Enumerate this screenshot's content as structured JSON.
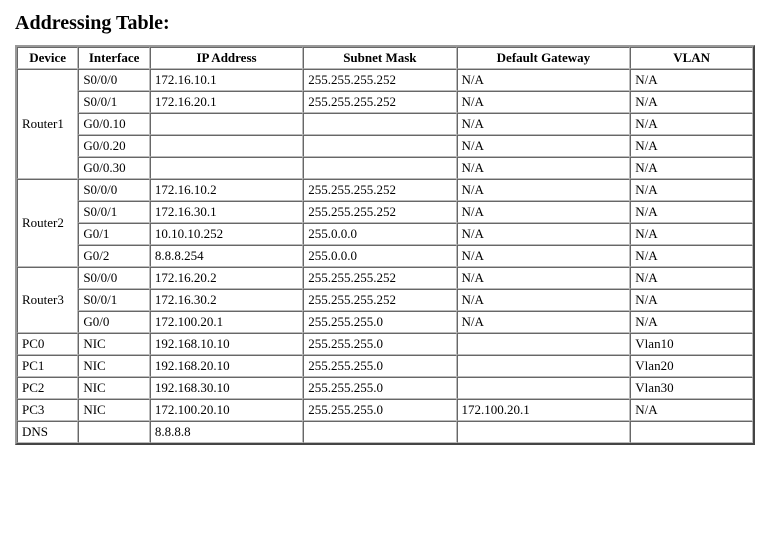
{
  "title": "Addressing Table:",
  "headers": {
    "device": "Device",
    "interface": "Interface",
    "ip": "IP Address",
    "mask": "Subnet Mask",
    "gw": "Default Gateway",
    "vlan": "VLAN"
  },
  "groups": [
    {
      "device": "Router1",
      "rows": [
        {
          "intf": "S0/0/0",
          "ip": "172.16.10.1",
          "mask": "255.255.255.252",
          "gw": "N/A",
          "vlan": "N/A"
        },
        {
          "intf": "S0/0/1",
          "ip": "172.16.20.1",
          "mask": "255.255.255.252",
          "gw": "N/A",
          "vlan": "N/A"
        },
        {
          "intf": "G0/0.10",
          "ip": "",
          "mask": "",
          "gw": "N/A",
          "vlan": "N/A"
        },
        {
          "intf": "G0/0.20",
          "ip": "",
          "mask": "",
          "gw": "N/A",
          "vlan": "N/A"
        },
        {
          "intf": "G0/0.30",
          "ip": "",
          "mask": "",
          "gw": "N/A",
          "vlan": "N/A"
        }
      ]
    },
    {
      "device": "Router2",
      "rows": [
        {
          "intf": "S0/0/0",
          "ip": "172.16.10.2",
          "mask": "255.255.255.252",
          "gw": "N/A",
          "vlan": "N/A"
        },
        {
          "intf": "S0/0/1",
          "ip": "172.16.30.1",
          "mask": "255.255.255.252",
          "gw": "N/A",
          "vlan": "N/A"
        },
        {
          "intf": "G0/1",
          "ip": "10.10.10.252",
          "mask": "255.0.0.0",
          "gw": "N/A",
          "vlan": "N/A"
        },
        {
          "intf": "G0/2",
          "ip": "8.8.8.254",
          "mask": "255.0.0.0",
          "gw": "N/A",
          "vlan": "N/A"
        }
      ]
    },
    {
      "device": "Router3",
      "rows": [
        {
          "intf": "S0/0/0",
          "ip": "172.16.20.2",
          "mask": "255.255.255.252",
          "gw": "N/A",
          "vlan": "N/A"
        },
        {
          "intf": "S0/0/1",
          "ip": "172.16.30.2",
          "mask": "255.255.255.252",
          "gw": "N/A",
          "vlan": "N/A"
        },
        {
          "intf": "G0/0",
          "ip": "172.100.20.1",
          "mask": "255.255.255.0",
          "gw": "N/A",
          "vlan": "N/A"
        }
      ]
    },
    {
      "device": "PC0",
      "rows": [
        {
          "intf": "NIC",
          "ip": "192.168.10.10",
          "mask": "255.255.255.0",
          "gw": "",
          "vlan": "Vlan10"
        }
      ]
    },
    {
      "device": "PC1",
      "rows": [
        {
          "intf": "NIC",
          "ip": "192.168.20.10",
          "mask": "255.255.255.0",
          "gw": "",
          "vlan": "Vlan20"
        }
      ]
    },
    {
      "device": "PC2",
      "rows": [
        {
          "intf": "NIC",
          "ip": "192.168.30.10",
          "mask": "255.255.255.0",
          "gw": "",
          "vlan": "Vlan30"
        }
      ]
    },
    {
      "device": "PC3",
      "rows": [
        {
          "intf": "NIC",
          "ip": "172.100.20.10",
          "mask": "255.255.255.0",
          "gw": "172.100.20.1",
          "vlan": "N/A"
        }
      ]
    },
    {
      "device": "DNS",
      "rows": [
        {
          "intf": "",
          "ip": "8.8.8.8",
          "mask": "",
          "gw": "",
          "vlan": ""
        }
      ]
    }
  ]
}
